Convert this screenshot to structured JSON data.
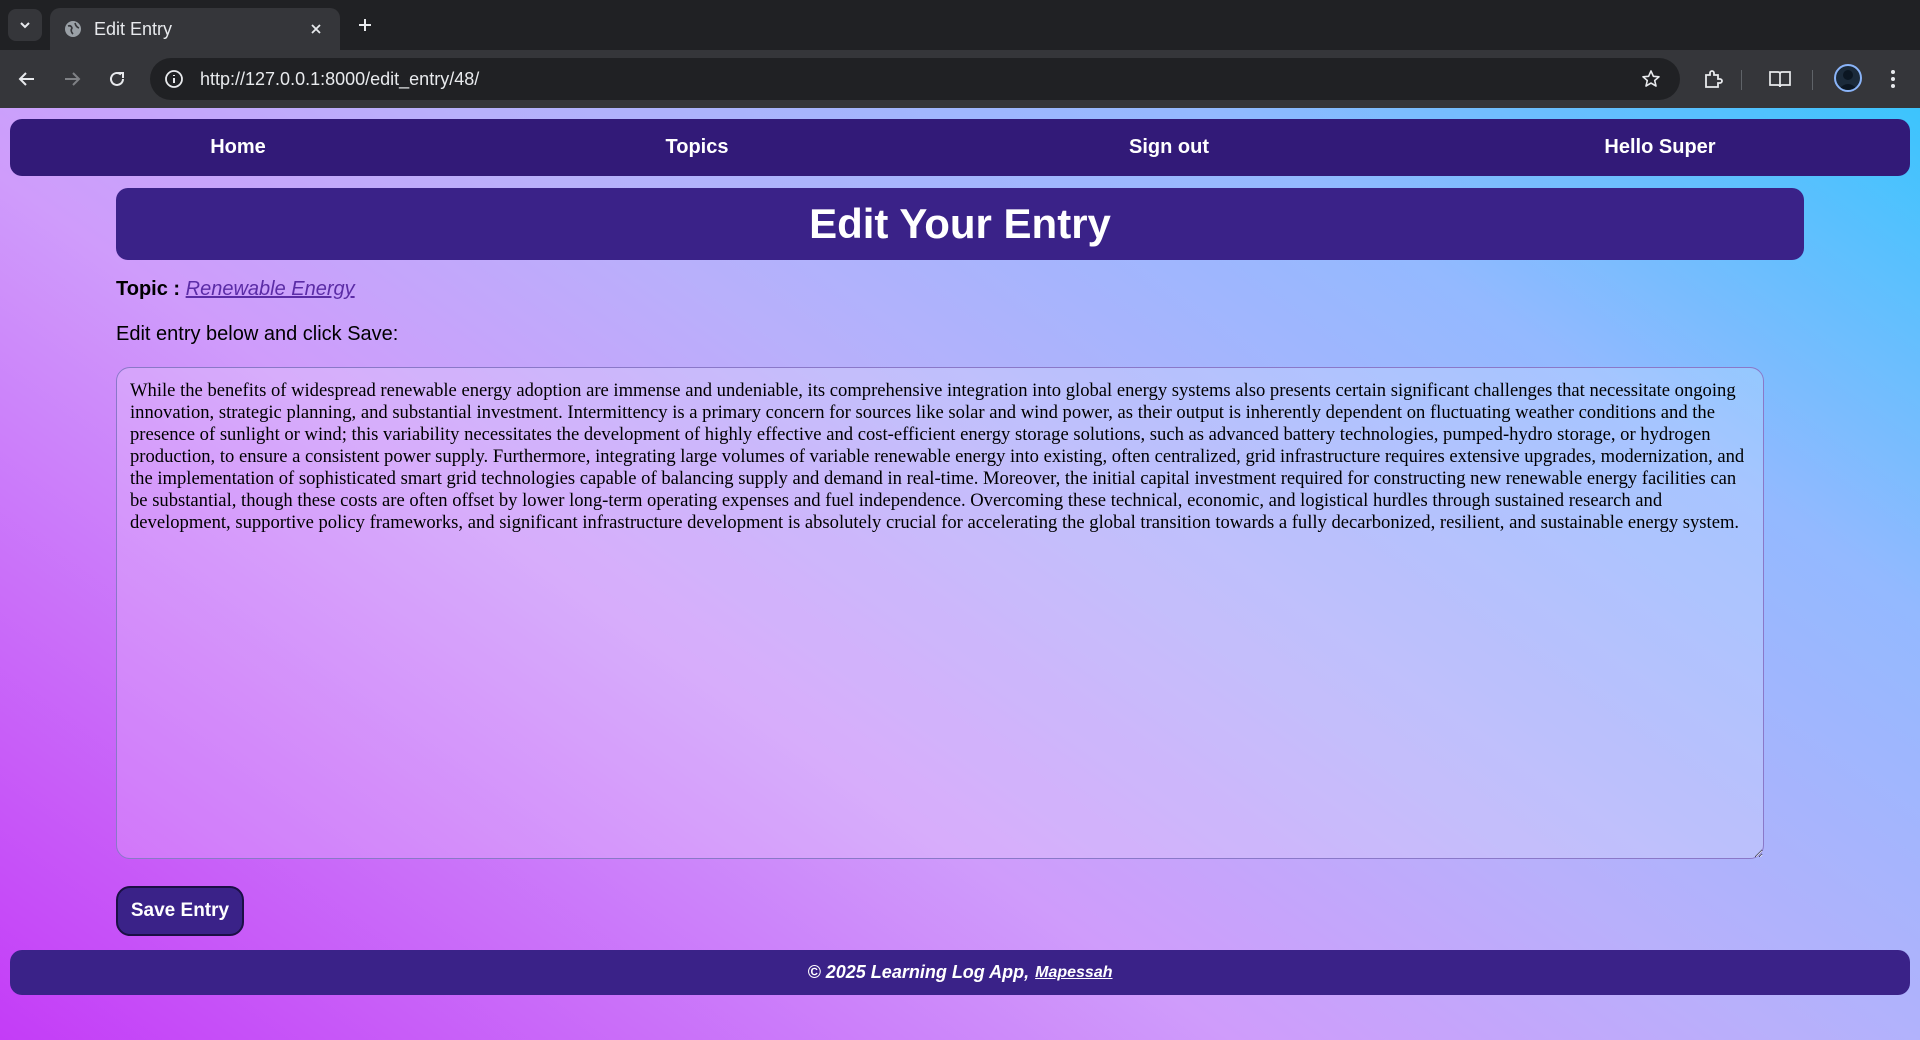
{
  "browser": {
    "tab_title": "Edit Entry",
    "url": "http://127.0.0.1:8000/edit_entry/48/",
    "icons": [
      "tab-dropdown-icon",
      "globe-icon",
      "close-icon",
      "plus-icon",
      "back-icon",
      "forward-icon",
      "reload-icon",
      "info-icon",
      "star-icon",
      "extensions-icon",
      "reading-mode-icon",
      "profile-avatar",
      "menu-icon"
    ]
  },
  "navbar": {
    "home": "Home",
    "topics": "Topics",
    "sign_out": "Sign out",
    "greeting": "Hello Super"
  },
  "page_title": "Edit Your Entry",
  "topic": {
    "label": "Topic :",
    "name": "Renewable Energy"
  },
  "instruction": "Edit entry below and click Save:",
  "entry_text": "While the benefits of widespread renewable energy adoption are immense and undeniable, its comprehensive integration into global energy systems also presents certain significant challenges that necessitate ongoing innovation, strategic planning, and substantial investment. Intermittency is a primary concern for sources like solar and wind power, as their output is inherently dependent on fluctuating weather conditions and the presence of sunlight or wind; this variability necessitates the development of highly effective and cost-efficient energy storage solutions, such as advanced battery technologies, pumped-hydro storage, or hydrogen production, to ensure a consistent power supply. Furthermore, integrating large volumes of variable renewable energy into existing, often centralized, grid infrastructure requires extensive upgrades, modernization, and the implementation of sophisticated smart grid technologies capable of balancing supply and demand in real-time. Moreover, the initial capital investment required for constructing new renewable energy facilities can be substantial, though these costs are often offset by lower long-term operating expenses and fuel independence. Overcoming these technical, economic, and logistical hurdles through sustained research and development, supportive policy frameworks, and significant infrastructure development is absolutely crucial for accelerating the global transition towards a fully decarbonized, resilient, and sustainable energy system.",
  "save_label": "Save Entry",
  "footer": {
    "text": "© 2025 Learning Log App,",
    "link": "Mapessah"
  },
  "colors": {
    "nav_bg": "#321a78",
    "title_bg": "#3a2288",
    "gradient_start": "#c43cf7",
    "gradient_end": "#3cc4fd"
  }
}
